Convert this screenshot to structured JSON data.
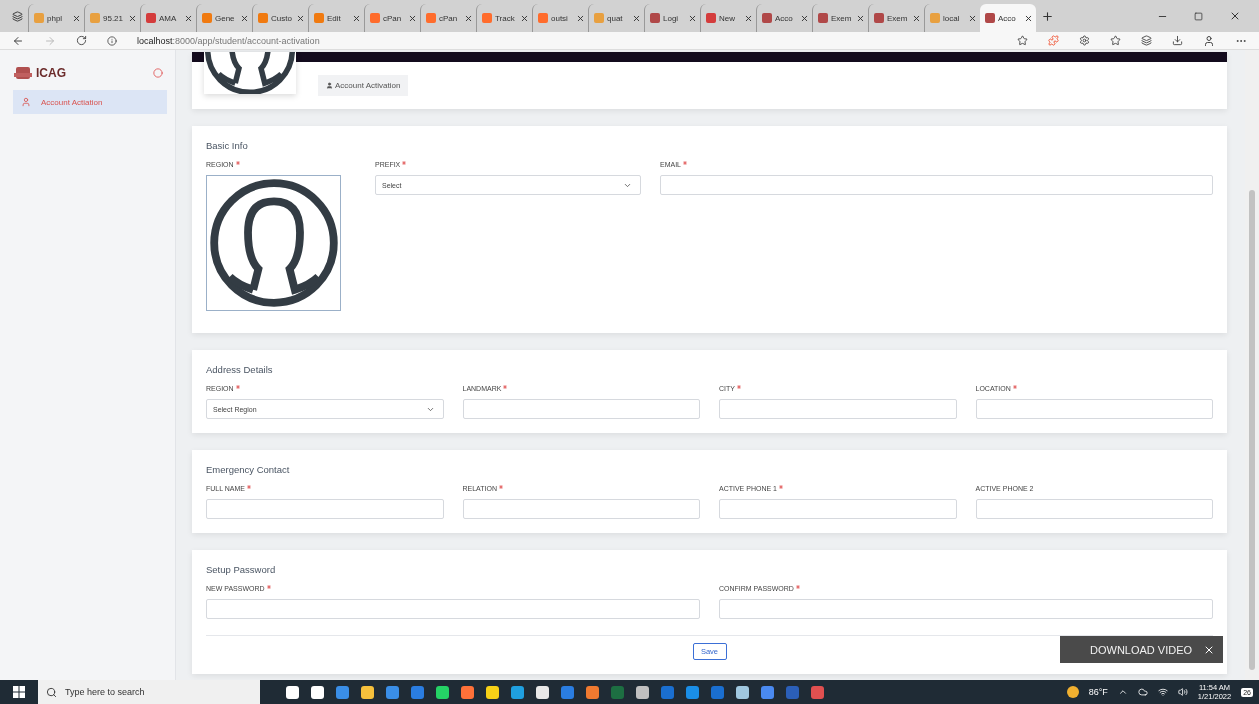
{
  "browser": {
    "tabs": [
      {
        "title": "phpl",
        "kind": "pma",
        "selected": false
      },
      {
        "title": "95.21",
        "kind": "pma",
        "selected": false
      },
      {
        "title": "AMA",
        "kind": "pdf",
        "selected": false
      },
      {
        "title": "Gene",
        "kind": "search",
        "selected": false
      },
      {
        "title": "Custo",
        "kind": "search",
        "selected": false
      },
      {
        "title": "Edit",
        "kind": "search",
        "selected": false
      },
      {
        "title": "cPan",
        "kind": "cpanel",
        "selected": false
      },
      {
        "title": "cPan",
        "kind": "cpanel",
        "selected": false
      },
      {
        "title": "Track",
        "kind": "cpanel",
        "selected": false
      },
      {
        "title": "outsi",
        "kind": "cpanel",
        "selected": false
      },
      {
        "title": "quat",
        "kind": "pma",
        "selected": false
      },
      {
        "title": "Logi",
        "kind": "school",
        "selected": false
      },
      {
        "title": "New",
        "kind": "pdf",
        "selected": false
      },
      {
        "title": "Acco",
        "kind": "school",
        "selected": false
      },
      {
        "title": "Exem",
        "kind": "school",
        "selected": false
      },
      {
        "title": "Exem",
        "kind": "school",
        "selected": false
      },
      {
        "title": "local",
        "kind": "pma",
        "selected": false
      },
      {
        "title": "Acco",
        "kind": "school",
        "selected": true
      }
    ],
    "url_host": "localhost",
    "url_path": ":8000/app/student/account-activation"
  },
  "sidebar": {
    "brand": "ICAG",
    "items": [
      {
        "label": "Account Actiation",
        "selected": true
      }
    ]
  },
  "header": {
    "button": "Account Activation"
  },
  "sections": [
    {
      "title": "Basic Info",
      "fields": [
        {
          "label": "REGION",
          "required": true,
          "kind": "photo"
        },
        {
          "label": "PREFIX",
          "required": true,
          "kind": "select",
          "value": "Select"
        },
        {
          "label": "EMAIL",
          "required": true,
          "kind": "text"
        }
      ]
    },
    {
      "title": "Address Details",
      "fields": [
        {
          "label": "REGION",
          "required": true,
          "kind": "select",
          "value": "Select Region"
        },
        {
          "label": "LANDMARK",
          "required": true,
          "kind": "text"
        },
        {
          "label": "CITY",
          "required": true,
          "kind": "text"
        },
        {
          "label": "LOCATION",
          "required": true,
          "kind": "text"
        }
      ]
    },
    {
      "title": "Emergency Contact",
      "fields": [
        {
          "label": "FULL NAME",
          "required": true,
          "kind": "text"
        },
        {
          "label": "RELATION",
          "required": true,
          "kind": "text"
        },
        {
          "label": "ACTIVE PHONE 1",
          "required": true,
          "kind": "text"
        },
        {
          "label": "ACTIVE PHONE 2",
          "required": false,
          "kind": "text"
        }
      ]
    },
    {
      "title": "Setup Password",
      "button": "Save",
      "fields": [
        {
          "label": "NEW PASSWORD",
          "required": true,
          "kind": "text"
        },
        {
          "label": "CONFIRM PASSWORD",
          "required": true,
          "kind": "text"
        }
      ]
    }
  ],
  "overlay": {
    "label": "DOWNLOAD VIDEO"
  },
  "taskbar": {
    "search_placeholder": "Type here to search",
    "weather": "86°F",
    "time": "11:54 AM",
    "date": "1/21/2022",
    "notifications": "26"
  }
}
